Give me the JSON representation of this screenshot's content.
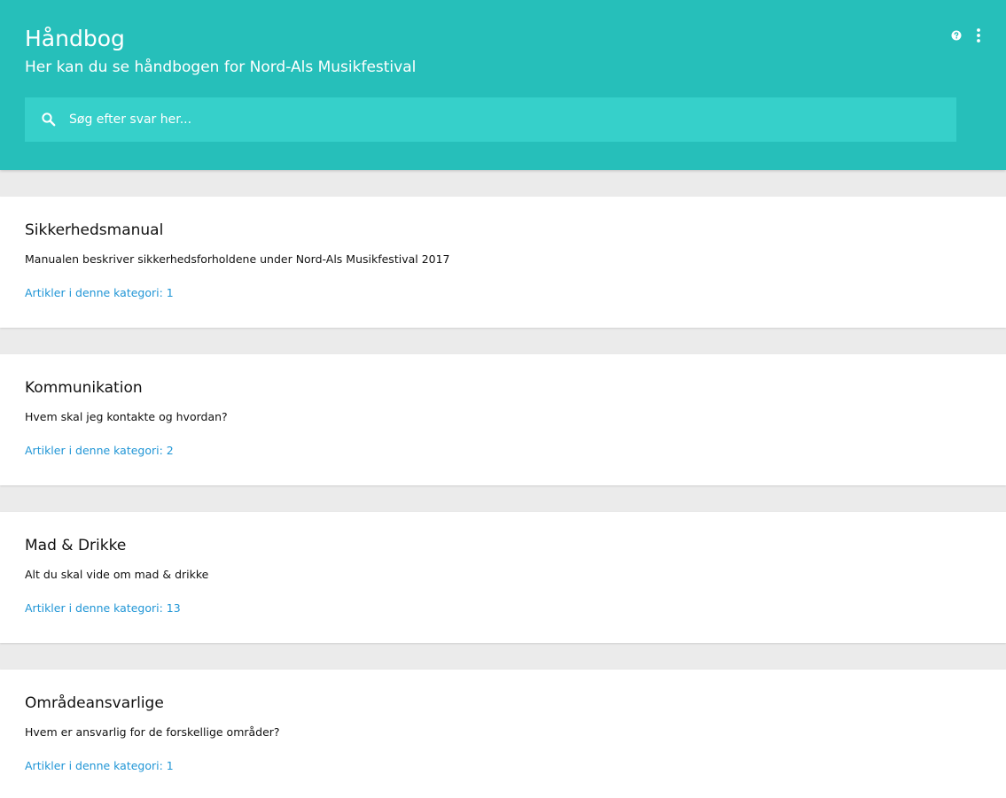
{
  "header": {
    "title": "Håndbog",
    "subtitle": "Her kan du se håndbogen for Nord-Als Musikfestival",
    "help_icon": "help-circle-icon",
    "more_icon": "more-vertical-icon"
  },
  "search": {
    "placeholder": "Søg efter svar her...",
    "icon": "search-icon"
  },
  "categories": [
    {
      "title": "Sikkerhedsmanual",
      "description": "Manualen beskriver sikkerhedsforholdene under Nord-Als Musikfestival 2017",
      "link": "Artikler i denne kategori: 1"
    },
    {
      "title": "Kommunikation",
      "description": "Hvem skal jeg kontakte og hvordan?",
      "link": "Artikler i denne kategori: 2"
    },
    {
      "title": "Mad & Drikke",
      "description": "Alt du skal vide om mad & drikke",
      "link": "Artikler i denne kategori: 13"
    },
    {
      "title": "Områdeansvarlige",
      "description": "Hvem er ansvarlig for de forskellige områder?",
      "link": "Artikler i denne kategori: 1"
    }
  ],
  "colors": {
    "header_bg": "#26bfba",
    "search_bg": "#36d0ca",
    "page_bg": "#ebebeb",
    "link": "#2196d6"
  }
}
